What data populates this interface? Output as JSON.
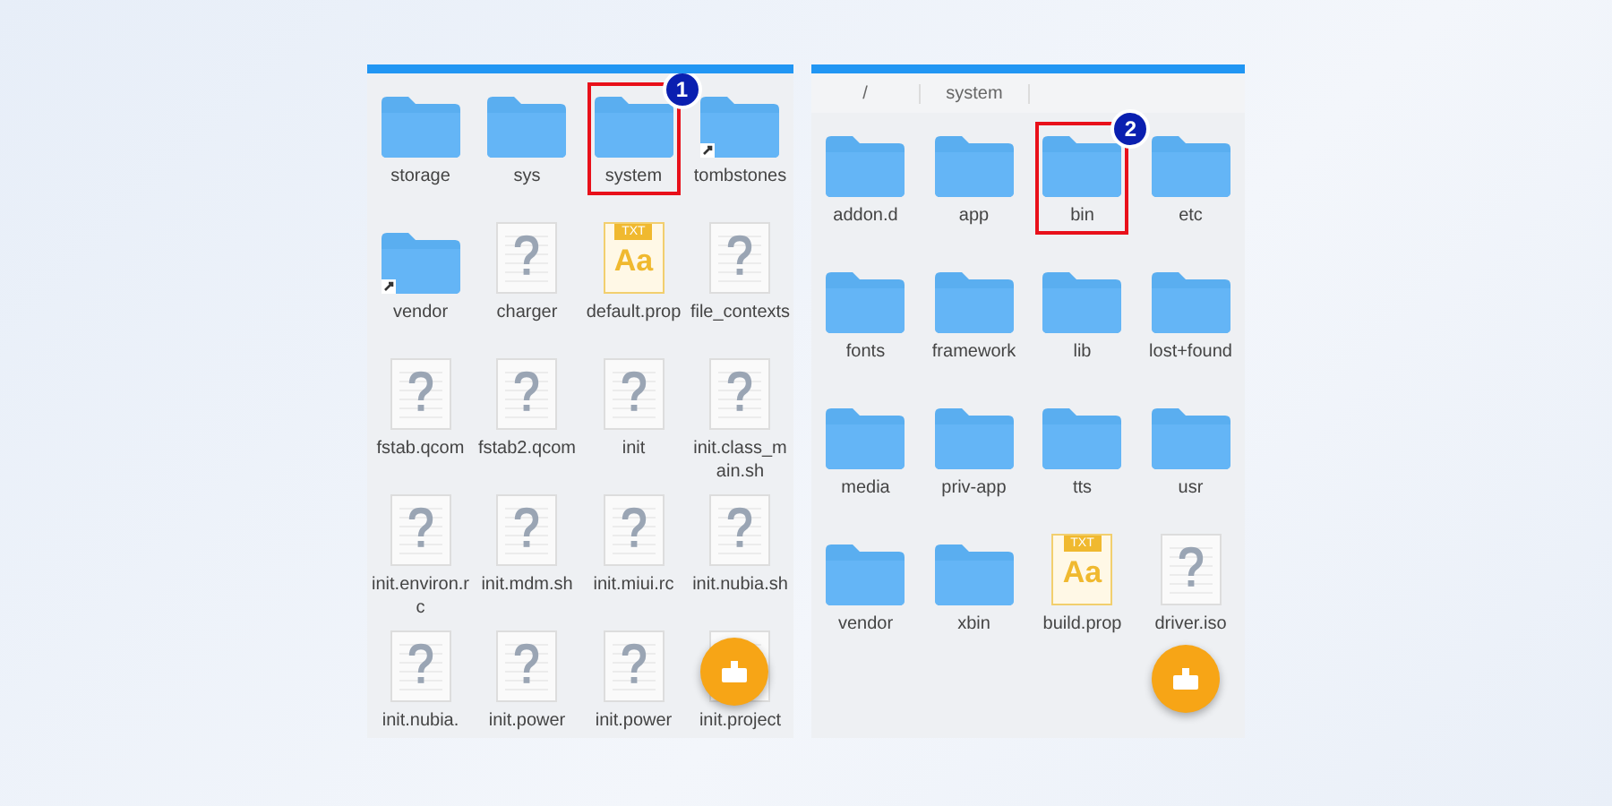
{
  "panels": [
    {
      "items": [
        {
          "name": "storage",
          "kind": "folder",
          "shortcut": false
        },
        {
          "name": "sys",
          "kind": "folder",
          "shortcut": false
        },
        {
          "name": "system",
          "kind": "folder",
          "shortcut": false,
          "badge": "1"
        },
        {
          "name": "tombstones",
          "kind": "folder",
          "shortcut": true
        },
        {
          "name": "vendor",
          "kind": "folder",
          "shortcut": true
        },
        {
          "name": "charger",
          "kind": "unknown"
        },
        {
          "name": "default.prop",
          "kind": "txt",
          "tag": "TXT",
          "glyph": "Aa"
        },
        {
          "name": "file_contexts",
          "kind": "unknown"
        },
        {
          "name": "fstab.qcom",
          "kind": "unknown"
        },
        {
          "name": "fstab2.qcom",
          "kind": "unknown"
        },
        {
          "name": "init",
          "kind": "unknown"
        },
        {
          "name": "init.class_main.sh",
          "kind": "unknown"
        },
        {
          "name": "init.environ.rc",
          "kind": "unknown"
        },
        {
          "name": "init.mdm.sh",
          "kind": "unknown"
        },
        {
          "name": "init.miui.rc",
          "kind": "unknown"
        },
        {
          "name": "init.nubia.sh",
          "kind": "unknown"
        },
        {
          "name": "init.nubia.",
          "kind": "unknown"
        },
        {
          "name": "init.power",
          "kind": "unknown"
        },
        {
          "name": "init.power",
          "kind": "unknown"
        },
        {
          "name": "init.project",
          "kind": "unknown"
        }
      ]
    },
    {
      "breadcrumb": [
        "/",
        "system"
      ],
      "items": [
        {
          "name": "addon.d",
          "kind": "folder",
          "shortcut": false
        },
        {
          "name": "app",
          "kind": "folder",
          "shortcut": false
        },
        {
          "name": "bin",
          "kind": "folder",
          "shortcut": false,
          "badge": "2"
        },
        {
          "name": "etc",
          "kind": "folder",
          "shortcut": false
        },
        {
          "name": "fonts",
          "kind": "folder",
          "shortcut": false
        },
        {
          "name": "framework",
          "kind": "folder",
          "shortcut": false
        },
        {
          "name": "lib",
          "kind": "folder",
          "shortcut": false
        },
        {
          "name": "lost+found",
          "kind": "folder",
          "shortcut": false
        },
        {
          "name": "media",
          "kind": "folder",
          "shortcut": false
        },
        {
          "name": "priv-app",
          "kind": "folder",
          "shortcut": false
        },
        {
          "name": "tts",
          "kind": "folder",
          "shortcut": false
        },
        {
          "name": "usr",
          "kind": "folder",
          "shortcut": false
        },
        {
          "name": "vendor",
          "kind": "folder",
          "shortcut": false
        },
        {
          "name": "xbin",
          "kind": "folder",
          "shortcut": false
        },
        {
          "name": "build.prop",
          "kind": "txt",
          "tag": "TXT",
          "glyph": "Aa"
        },
        {
          "name": "driver.iso",
          "kind": "unknown"
        }
      ]
    }
  ]
}
